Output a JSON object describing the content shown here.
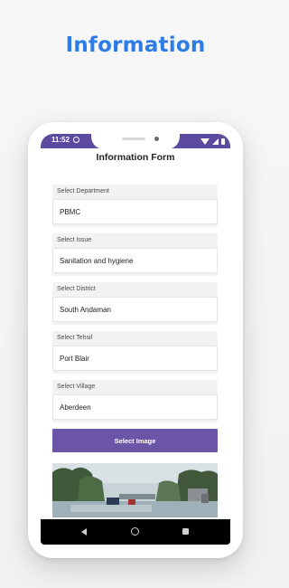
{
  "headline": "Information",
  "status_bar": {
    "time": "11:52",
    "icons": [
      "settings-icon",
      "wifi-icon",
      "signal-icon",
      "battery-icon"
    ],
    "color": "#5c4b9e"
  },
  "form": {
    "title": "Information Form",
    "fields": [
      {
        "label": "Select Department",
        "value": "PBMC"
      },
      {
        "label": "Select Issue",
        "value": "Sanitation and hygiene"
      },
      {
        "label": "Select District",
        "value": "South Andaman"
      },
      {
        "label": "Select Tehsil",
        "value": "Port Blair"
      },
      {
        "label": "Select Village",
        "value": "Aberdeen"
      }
    ],
    "select_image_label": "Select Image",
    "button_color": "#6a55a7"
  },
  "navbar": {
    "icons": [
      "back-icon",
      "home-icon",
      "recents-icon"
    ]
  },
  "accent_color": "#2d7be5"
}
